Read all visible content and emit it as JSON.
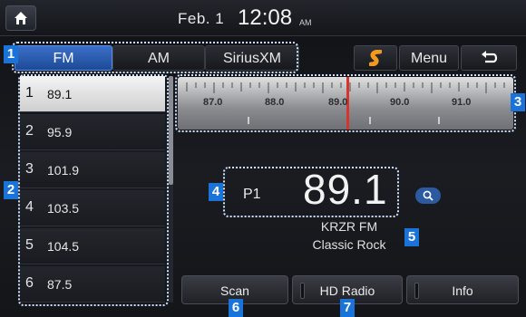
{
  "status_bar": {
    "date": "Feb.  1",
    "time": "12:08",
    "ampm": "AM"
  },
  "bands": {
    "tabs": [
      "FM",
      "AM",
      "SiriusXM"
    ],
    "active": "FM"
  },
  "top_buttons": {
    "menu_label": "Menu"
  },
  "presets": [
    {
      "num": "1",
      "freq": "89.1",
      "selected": true
    },
    {
      "num": "2",
      "freq": "95.9"
    },
    {
      "num": "3",
      "freq": "101.9"
    },
    {
      "num": "4",
      "freq": "103.5"
    },
    {
      "num": "5",
      "freq": "104.5"
    },
    {
      "num": "6",
      "freq": "87.5"
    }
  ],
  "dial": {
    "labels": [
      "87.0",
      "88.0",
      "89.0",
      "90.0",
      "91.0"
    ],
    "tuned": "89.1"
  },
  "now_playing": {
    "preset_tag": "P1",
    "frequency": "89.1",
    "station": "KRZR FM",
    "genre": "Classic Rock"
  },
  "bottom_buttons": {
    "scan_label": "Scan",
    "hd_label": "HD Radio",
    "info_label": "Info"
  },
  "markers": [
    "1",
    "2",
    "3",
    "4",
    "5",
    "6",
    "7"
  ],
  "colors": {
    "accent": "#1a73d9",
    "active_tab": "#2f62b8",
    "needle": "#d9332b"
  }
}
